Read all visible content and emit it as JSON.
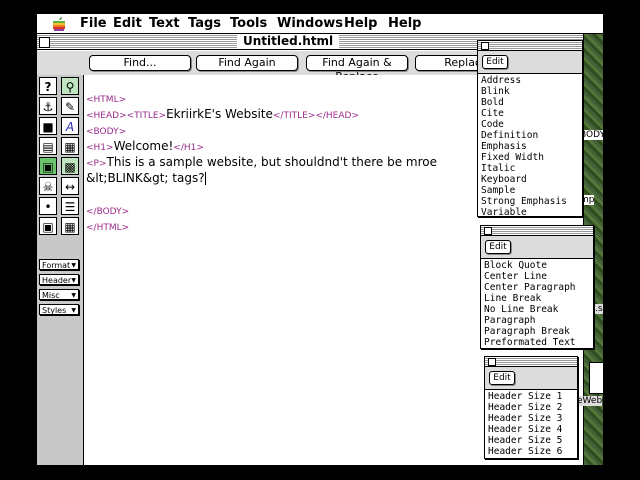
{
  "menubar": {
    "items": [
      "File",
      "Edit",
      "Text",
      "Tags",
      "Tools",
      "Windows",
      "Help",
      "Help"
    ]
  },
  "window": {
    "title": "Untitled.html"
  },
  "toolbar": {
    "buttons": [
      "Find...",
      "Find Again",
      "Find Again & Replace",
      "Replace"
    ]
  },
  "popups": {
    "format": "Format",
    "header": "Header",
    "misc": "Misc",
    "styles": "Styles"
  },
  "editor": {
    "lines": [
      {
        "tag_open": "<HTML>",
        "text": "",
        "tag_close": ""
      },
      {
        "tag_open": "<HEAD><TITLE>",
        "text": "EkriirkE's Website",
        "tag_close": "</TITLE></HEAD>"
      },
      {
        "tag_open": "<BODY>",
        "text": "",
        "tag_close": ""
      },
      {
        "tag_open": "<H1>",
        "text": "Welcome!",
        "tag_close": "</H1>"
      },
      {
        "tag_open": "<P>",
        "text": "This is a sample website, but shouldnd't there be mroe",
        "tag_close": ""
      },
      {
        "tag_open": "",
        "text": "&lt;BLINK&gt; tags?",
        "tag_close": ""
      },
      {
        "tag_open": "",
        "text": "",
        "tag_close": ""
      },
      {
        "tag_open": "</BODY>",
        "text": "",
        "tag_close": ""
      },
      {
        "tag_open": "</HTML>",
        "text": "",
        "tag_close": ""
      }
    ]
  },
  "styles_palette": {
    "edit_label": "Edit",
    "items": [
      "Address",
      "Blink",
      "Bold",
      "Cite",
      "Code",
      "Definition",
      "Emphasis",
      "Fixed Width",
      "Italic",
      "Keyboard",
      "Sample",
      "Strong Emphasis",
      "Variable"
    ]
  },
  "format_palette": {
    "edit_label": "Edit",
    "items": [
      "Block Quote",
      "Center Line",
      "Center Paragraph",
      "Line Break",
      "No Line Break",
      "Paragraph",
      "Paragraph Break",
      "Preformated Text"
    ]
  },
  "header_palette": {
    "edit_label": "Edit",
    "items": [
      "Header Size 1",
      "Header Size 2",
      "Header Size 3",
      "Header Size 4",
      "Header Size 5",
      "Header Size 6"
    ]
  },
  "background_fragments": [
    "BODY",
    "mp",
    ".s",
    "eWeb"
  ]
}
